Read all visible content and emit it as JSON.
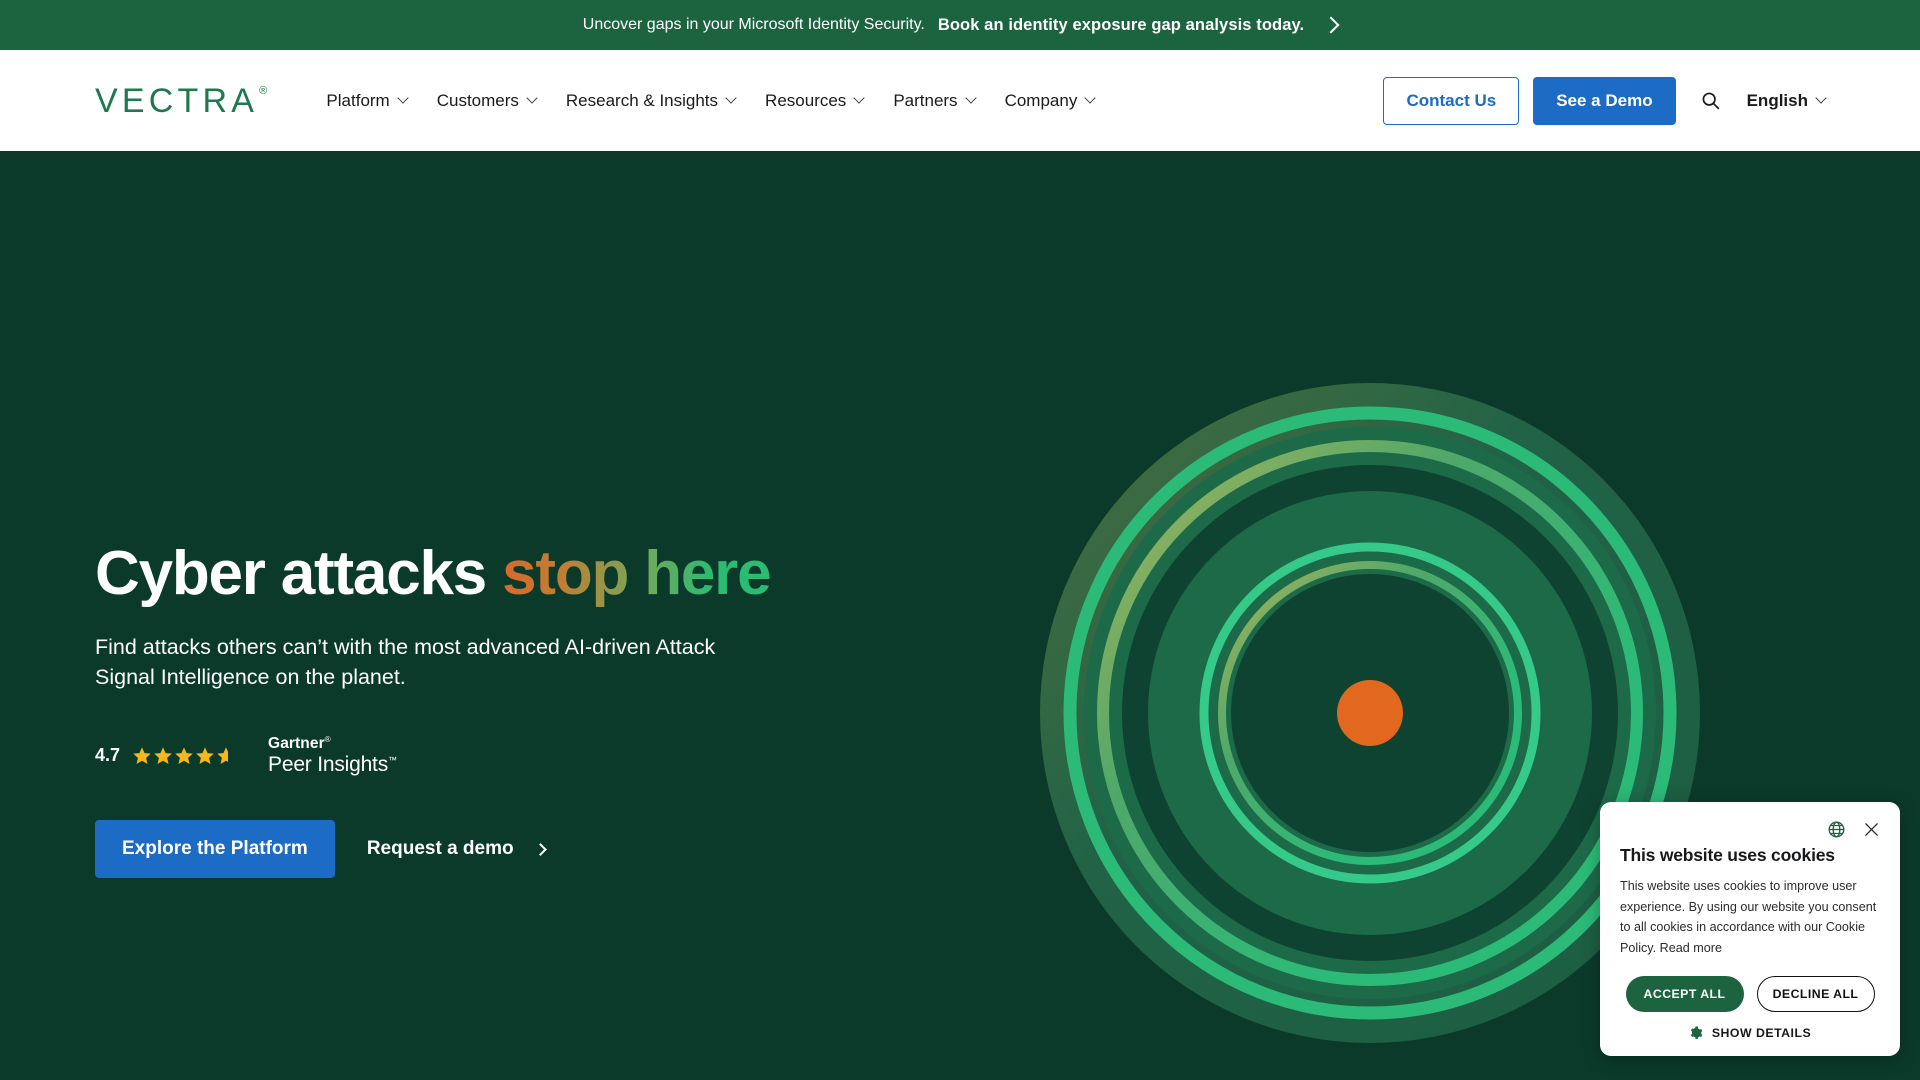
{
  "announcement": {
    "text": "Uncover gaps in your Microsoft Identity Security.",
    "link_label": "Book an identity exposure gap analysis today.",
    "chevron_icon": "chevron-right-icon"
  },
  "nav": {
    "logo_text": "VECTRA",
    "logo_trademark": "®",
    "items": [
      {
        "label": "Platform",
        "caret_icon": "chevron-down-icon"
      },
      {
        "label": "Customers",
        "caret_icon": "chevron-down-icon"
      },
      {
        "label": "Research & Insights",
        "caret_icon": "chevron-down-icon"
      },
      {
        "label": "Resources",
        "caret_icon": "chevron-down-icon"
      },
      {
        "label": "Partners",
        "caret_icon": "chevron-down-icon"
      },
      {
        "label": "Company",
        "caret_icon": "chevron-down-icon"
      }
    ],
    "contact_label": "Contact Us",
    "demo_label": "See a Demo",
    "search_icon": "search-icon",
    "language_label": "English",
    "language_caret_icon": "chevron-down-icon"
  },
  "hero": {
    "headline_plain": "Cyber attacks ",
    "headline_gradient": "stop here",
    "subheading": "Find attacks others can’t with the most advanced AI-driven Attack Signal Intelligence on the planet.",
    "rating": {
      "score": "4.7",
      "stars_total": 5,
      "stars_filled": 4,
      "stars_partial": 1,
      "star_icon": "star-icon",
      "brand_line1": "Gartner",
      "brand_line1_mark": "®",
      "brand_line2": "Peer Insights",
      "brand_line2_mark": "™"
    },
    "cta_primary": "Explore the Platform",
    "cta_secondary": "Request a demo",
    "cta_secondary_icon": "chevron-right-icon",
    "graphic": {
      "name": "concentric-rings-graphic",
      "center_dot_color": "#E2671F",
      "ring_color": "#2CBA78",
      "disc_color": "#1D6A49",
      "background_color": "#0B3A2B"
    }
  },
  "cookie_banner": {
    "globe_icon": "globe-icon",
    "close_icon": "close-icon",
    "title": "This website uses cookies",
    "body": "This website uses cookies to improve user experience. By using our website you consent to all cookies in accordance with our Cookie Policy. Read more",
    "accept_label": "ACCEPT ALL",
    "decline_label": "DECLINE ALL",
    "details_label": "SHOW DETAILS",
    "details_icon": "gear-icon"
  },
  "colors": {
    "brand_green": "#1C6340",
    "logo_green": "#1E7A4C",
    "hero_bg": "#0B3A2B",
    "accent_blue": "#1C6BC4",
    "orange": "#E2671F",
    "bright_green": "#2CBA78",
    "star_gold": "#F5B81C"
  }
}
